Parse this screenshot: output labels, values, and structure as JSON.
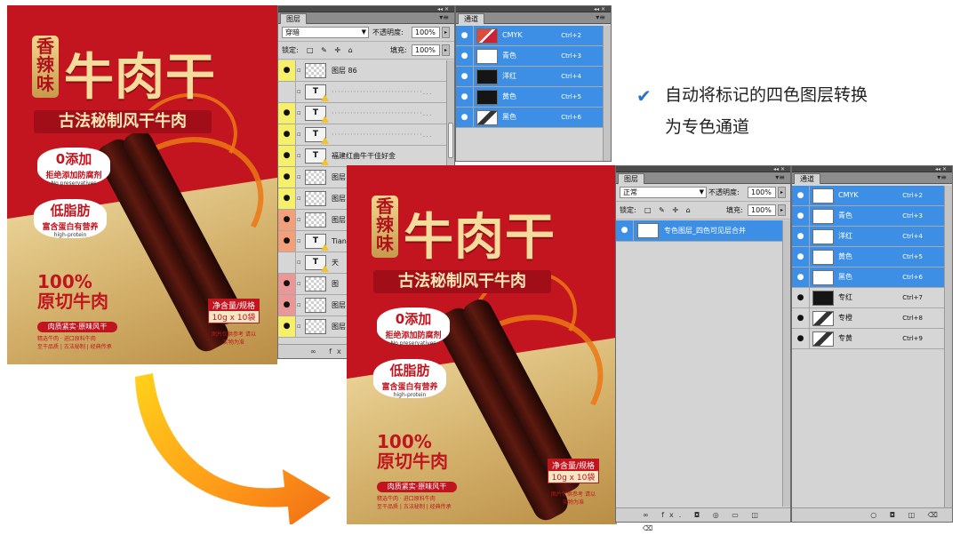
{
  "poster": {
    "badge_text": "香辣味",
    "title": "牛肉干",
    "subtitle": "古法秘制风干牛肉",
    "badge1_title": "0添加",
    "badge1_sub": "拒绝添加防腐剂",
    "badge1_en": "No preservatives",
    "badge2_title": "低脂肪",
    "badge2_sub": "富含蛋白有营养",
    "badge2_en": "high-protein",
    "percent": "100%",
    "percent_label": "原切牛肉",
    "tagline": "肉质紧实·原味风干",
    "small1": "精选牛肉 · 进口原料牛肉",
    "small2": "至干品质 | 古法秘制 | 经典传承",
    "spec_label": "净含量/规格",
    "spec_value": "10g x 10袋",
    "note": "图片仅供参考 请以实物为准"
  },
  "layers_panel_before": {
    "tab": "图层",
    "blend_mode": "穿暗",
    "opacity_label": "不透明度:",
    "opacity_value": "100%",
    "lock_label": "锁定:",
    "lock_icons": "□ ✎ ✛ ⌂",
    "fill_label": "填充:",
    "fill_value": "100%",
    "layers": [
      {
        "eye": "yellow",
        "type": "pixel",
        "name": "图层 86"
      },
      {
        "eye": "none",
        "type": "text",
        "name": "·····························..."
      },
      {
        "eye": "yellow",
        "type": "text",
        "name": "·····························..."
      },
      {
        "eye": "yellow",
        "type": "text",
        "name": "·····························..."
      },
      {
        "eye": "yellow",
        "type": "text",
        "name": "福建红曲牛干佳好金"
      },
      {
        "eye": "yellow",
        "type": "pixel",
        "name": "图层"
      },
      {
        "eye": "yellow",
        "type": "pixel",
        "name": "图层"
      },
      {
        "eye": "orange",
        "type": "pixel",
        "name": "图层"
      },
      {
        "eye": "orange",
        "type": "text",
        "name": "Tian R"
      },
      {
        "eye": "none",
        "type": "text",
        "name": "天"
      },
      {
        "eye": "red",
        "type": "pixel",
        "name": "图"
      },
      {
        "eye": "red",
        "type": "pixel",
        "name": "图层"
      },
      {
        "eye": "yellow",
        "type": "pixel",
        "name": "图层"
      }
    ],
    "footer": "∞ fx."
  },
  "channels_panel_before": {
    "tab": "通道",
    "channels": [
      {
        "name": "CMYK",
        "key": "Ctrl+2",
        "thumb": "cmyk"
      },
      {
        "name": "青色",
        "key": "Ctrl+3",
        "thumb": "white"
      },
      {
        "name": "洋红",
        "key": "Ctrl+4",
        "thumb": "black"
      },
      {
        "name": "黄色",
        "key": "Ctrl+5",
        "thumb": "black"
      },
      {
        "name": "黑色",
        "key": "Ctrl+6",
        "thumb": "bw"
      }
    ]
  },
  "caption": {
    "line1": "自动将标记的四色图层转换",
    "line2": "为专色通道"
  },
  "layers_panel_after": {
    "tab": "图层",
    "blend_mode": "正常",
    "opacity_label": "不透明度:",
    "opacity_value": "100%",
    "lock_label": "锁定:",
    "lock_icons": "□ ✎ ✛ ⌂",
    "fill_label": "填充:",
    "fill_value": "100%",
    "layer_name": "专色图层_四色可见层合并",
    "footer": "∞ fx. ◘ ◎ ▭ ◫ ⌫"
  },
  "channels_panel_after": {
    "tab": "通道",
    "channels": [
      {
        "name": "CMYK",
        "key": "Ctrl+2",
        "thumb": "white",
        "selected": true
      },
      {
        "name": "青色",
        "key": "Ctrl+3",
        "thumb": "white",
        "selected": true
      },
      {
        "name": "洋红",
        "key": "Ctrl+4",
        "thumb": "white",
        "selected": true
      },
      {
        "name": "黄色",
        "key": "Ctrl+5",
        "thumb": "white",
        "selected": true
      },
      {
        "name": "黑色",
        "key": "Ctrl+6",
        "thumb": "white",
        "selected": true
      },
      {
        "name": "专红",
        "key": "Ctrl+7",
        "thumb": "black",
        "selected": false
      },
      {
        "name": "专橙",
        "key": "Ctrl+8",
        "thumb": "bw",
        "selected": false
      },
      {
        "name": "专黄",
        "key": "Ctrl+9",
        "thumb": "bw",
        "selected": false
      }
    ],
    "footer": "○ ◘ ◫ ⌫"
  },
  "colors": {
    "poster_red": "#c2151f",
    "poster_gold": "#d3b06a",
    "selection_blue": "#3d8fe6",
    "check_blue": "#2a73c9"
  }
}
